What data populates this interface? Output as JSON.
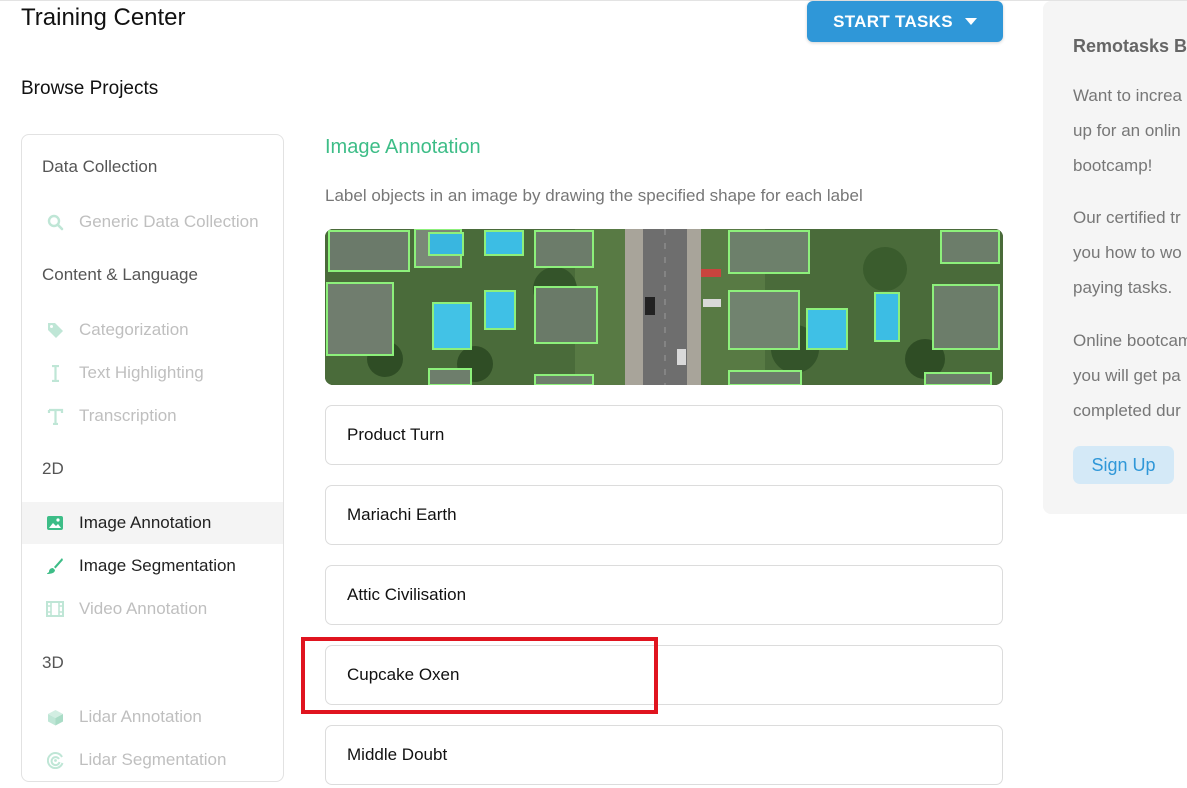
{
  "header": {
    "title": "Training Center",
    "subtitle": "Browse Projects",
    "start_tasks_label": "START TASKS"
  },
  "sidebar": {
    "groups": [
      {
        "label": "Data Collection",
        "items": [
          {
            "label": "Generic Data Collection",
            "icon": "search-icon",
            "state": "disabled"
          }
        ]
      },
      {
        "label": "Content & Language",
        "items": [
          {
            "label": "Categorization",
            "icon": "tag-icon",
            "state": "disabled"
          },
          {
            "label": "Text Highlighting",
            "icon": "text-cursor-icon",
            "state": "disabled"
          },
          {
            "label": "Transcription",
            "icon": "text-icon",
            "state": "disabled"
          }
        ]
      },
      {
        "label": "2D",
        "items": [
          {
            "label": "Image Annotation",
            "icon": "image-icon",
            "state": "selected"
          },
          {
            "label": "Image Segmentation",
            "icon": "brush-icon",
            "state": "enabled"
          },
          {
            "label": "Video Annotation",
            "icon": "film-icon",
            "state": "disabled"
          }
        ]
      },
      {
        "label": "3D",
        "items": [
          {
            "label": "Lidar Annotation",
            "icon": "cube-icon",
            "state": "disabled"
          },
          {
            "label": "Lidar Segmentation",
            "icon": "radar-icon",
            "state": "disabled"
          }
        ]
      }
    ]
  },
  "main": {
    "section_title": "Image Annotation",
    "section_description": "Label objects in an image by drawing the specified shape for each label",
    "projects": [
      {
        "label": "Product Turn"
      },
      {
        "label": "Mariachi Earth"
      },
      {
        "label": "Attic Civilisation"
      },
      {
        "label": "Cupcake Oxen"
      },
      {
        "label": "Middle Doubt"
      }
    ]
  },
  "promo": {
    "title": "Remotasks B",
    "paragraphs": [
      [
        "Want to increa",
        "up for an onlin",
        "bootcamp!"
      ],
      [
        "Our certified tr",
        "you how to wo",
        "paying tasks."
      ],
      [
        "Online bootcam",
        "you will get pa",
        "completed dur"
      ]
    ],
    "signup_label": "Sign Up"
  },
  "colors": {
    "accent_blue": "#2f97d8",
    "accent_green": "#3dbd87",
    "highlight_red": "#e0141f"
  }
}
